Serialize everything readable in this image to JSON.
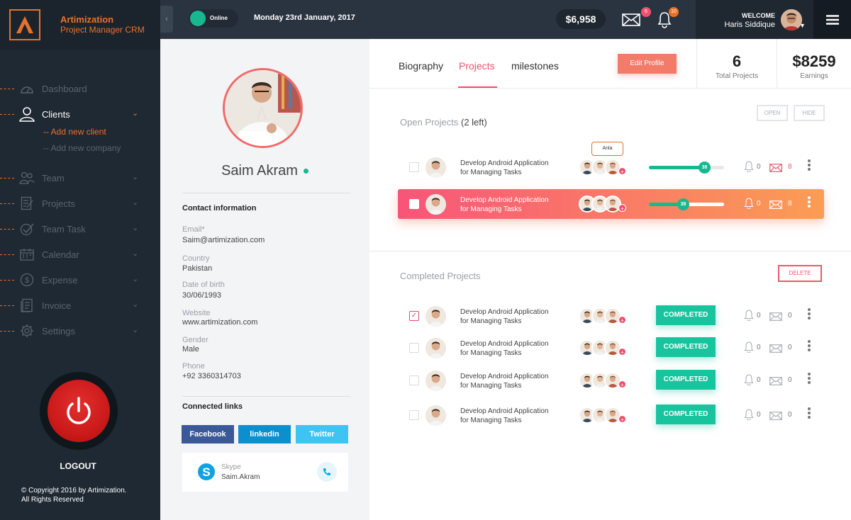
{
  "brand": {
    "name": "Artimization",
    "subtitle": "Project Manager CRM"
  },
  "nav": {
    "items": [
      {
        "label": "Dashboard",
        "icon": "dashboard-icon",
        "has_chevron": false
      },
      {
        "label": "Clients",
        "icon": "user-icon",
        "has_chevron": true,
        "active": true
      },
      {
        "label": "Team",
        "icon": "team-icon",
        "has_chevron": true
      },
      {
        "label": "Projects",
        "icon": "projects-icon",
        "has_chevron": true
      },
      {
        "label": "Team Task",
        "icon": "task-check-icon",
        "has_chevron": true
      },
      {
        "label": "Calendar",
        "icon": "calendar-icon",
        "has_chevron": true
      },
      {
        "label": "Expense",
        "icon": "dollar-icon",
        "has_chevron": true
      },
      {
        "label": "Invoice",
        "icon": "invoice-icon",
        "has_chevron": true
      },
      {
        "label": "Settings",
        "icon": "gear-icon",
        "has_chevron": true
      }
    ],
    "subitems": [
      "-- Add new client",
      "-- Add new company"
    ]
  },
  "logout": {
    "label": "LOGOUT"
  },
  "copyright": {
    "line1": "© Copyright 2016 by Artimization.",
    "line2": "All Rights Reserved"
  },
  "topbar": {
    "status": "Online",
    "date": "Monday 23rd January, 2017",
    "balance": "$6,958",
    "mail_badge": "6",
    "bell_badge": "10",
    "welcome": "WELCOME",
    "user_name": "Haris Siddique"
  },
  "profile": {
    "name": "Saim Akram",
    "contact_heading": "Contact information",
    "fields": [
      {
        "label": "Email*",
        "value": "Saim@artimization.com"
      },
      {
        "label": "Country",
        "value": "Pakistan"
      },
      {
        "label": "Date of birth",
        "value": "30/06/1993"
      },
      {
        "label": "Website",
        "value": "www.artimization.com"
      },
      {
        "label": "Gender",
        "value": "Male"
      },
      {
        "label": "Phone",
        "value": "+92 3360314703"
      }
    ],
    "links_heading": "Connected links",
    "social": [
      "Facebook",
      "linkedin",
      "Twitter"
    ],
    "skype": {
      "label": "Skype",
      "handle": "Saim.Akram"
    }
  },
  "tabs": [
    "Biography",
    "Projects",
    "milestones"
  ],
  "edit_profile": "Edit Profile",
  "stats": [
    {
      "value": "6",
      "label": "Total Projects"
    },
    {
      "value": "$8259",
      "label": "Earnings"
    }
  ],
  "open_projects": {
    "title": "Open Projects",
    "count": "(2 left)",
    "open_btn": "OPEN",
    "hide_btn": "HIDE",
    "tooltip": "Anla",
    "rows": [
      {
        "title_line1": "Develop Android Application",
        "title_line2": "for Managing Tasks",
        "progress": 38,
        "bells": "0",
        "mails": "8"
      },
      {
        "title_line1": "Develop Android Application",
        "title_line2": "for Managing Tasks",
        "progress": 38,
        "bells": "0",
        "mails": "8"
      }
    ]
  },
  "completed_projects": {
    "title": "Completed Projects",
    "delete_btn": "DELETE",
    "rows": [
      {
        "title_line1": "Develop Android Application",
        "title_line2": "for Managing Tasks",
        "status": "COMPLETED",
        "bells": "0",
        "mails": "0"
      },
      {
        "title_line1": "Develop Android Application",
        "title_line2": "for Managing Tasks",
        "status": "COMPLETED",
        "bells": "0",
        "mails": "0"
      },
      {
        "title_line1": "Develop Android Application",
        "title_line2": "for Managing Tasks",
        "status": "COMPLETED",
        "bells": "0",
        "mails": "0"
      },
      {
        "title_line1": "Develop Android Application",
        "title_line2": "for Managing Tasks",
        "status": "COMPLETED",
        "bells": "0",
        "mails": "0"
      }
    ]
  },
  "colors": {
    "accent": "#e8712a",
    "pink": "#f0506e",
    "green": "#17b890",
    "sidebar": "#1f2933"
  }
}
